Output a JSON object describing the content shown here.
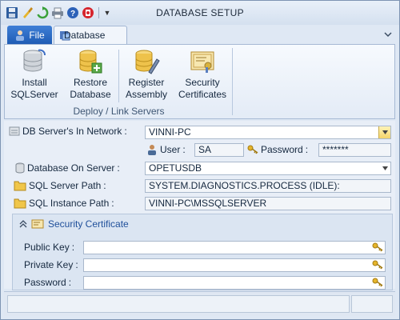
{
  "window": {
    "title": "DATABASE SETUP",
    "quick_access": [
      "save-icon",
      "brush-icon",
      "refresh-icon",
      "print-icon",
      "help-icon",
      "flag-icon"
    ]
  },
  "tabs": {
    "file": "File",
    "database": "Database"
  },
  "ribbon": {
    "buttons": [
      {
        "line1": "Install",
        "line2": "SQLServer"
      },
      {
        "line1": "Restore",
        "line2": "Database"
      },
      {
        "line1": "Register",
        "line2": "Assembly"
      },
      {
        "line1": "Security",
        "line2": "Certificates"
      }
    ],
    "group_label": "Deploy / Link Servers"
  },
  "form": {
    "db_server_label": "DB Server's In Network",
    "db_server_value": "VINNI-PC",
    "user_label": "User",
    "user_value": "SA",
    "password_label": "Password",
    "password_value": "*******",
    "db_on_server_label": "Database On Server",
    "db_on_server_value": "OPETUSDB",
    "sql_server_path_label": "SQL Server Path",
    "sql_server_path_value": "SYSTEM.DIAGNOSTICS.PROCESS (IDLE):",
    "sql_instance_path_label": "SQL Instance Path",
    "sql_instance_path_value": "VINNI-PC\\MSSQLSERVER",
    "colon": ":"
  },
  "security": {
    "header": "Security Certificate",
    "public_key_label": "Public Key",
    "private_key_label": "Private Key",
    "password_label": "Password",
    "colon": ":"
  },
  "colors": {
    "accent": "#1f5cb5",
    "ribbon_bg": "#e3ebf6",
    "window_bg": "#dfe8f4"
  }
}
